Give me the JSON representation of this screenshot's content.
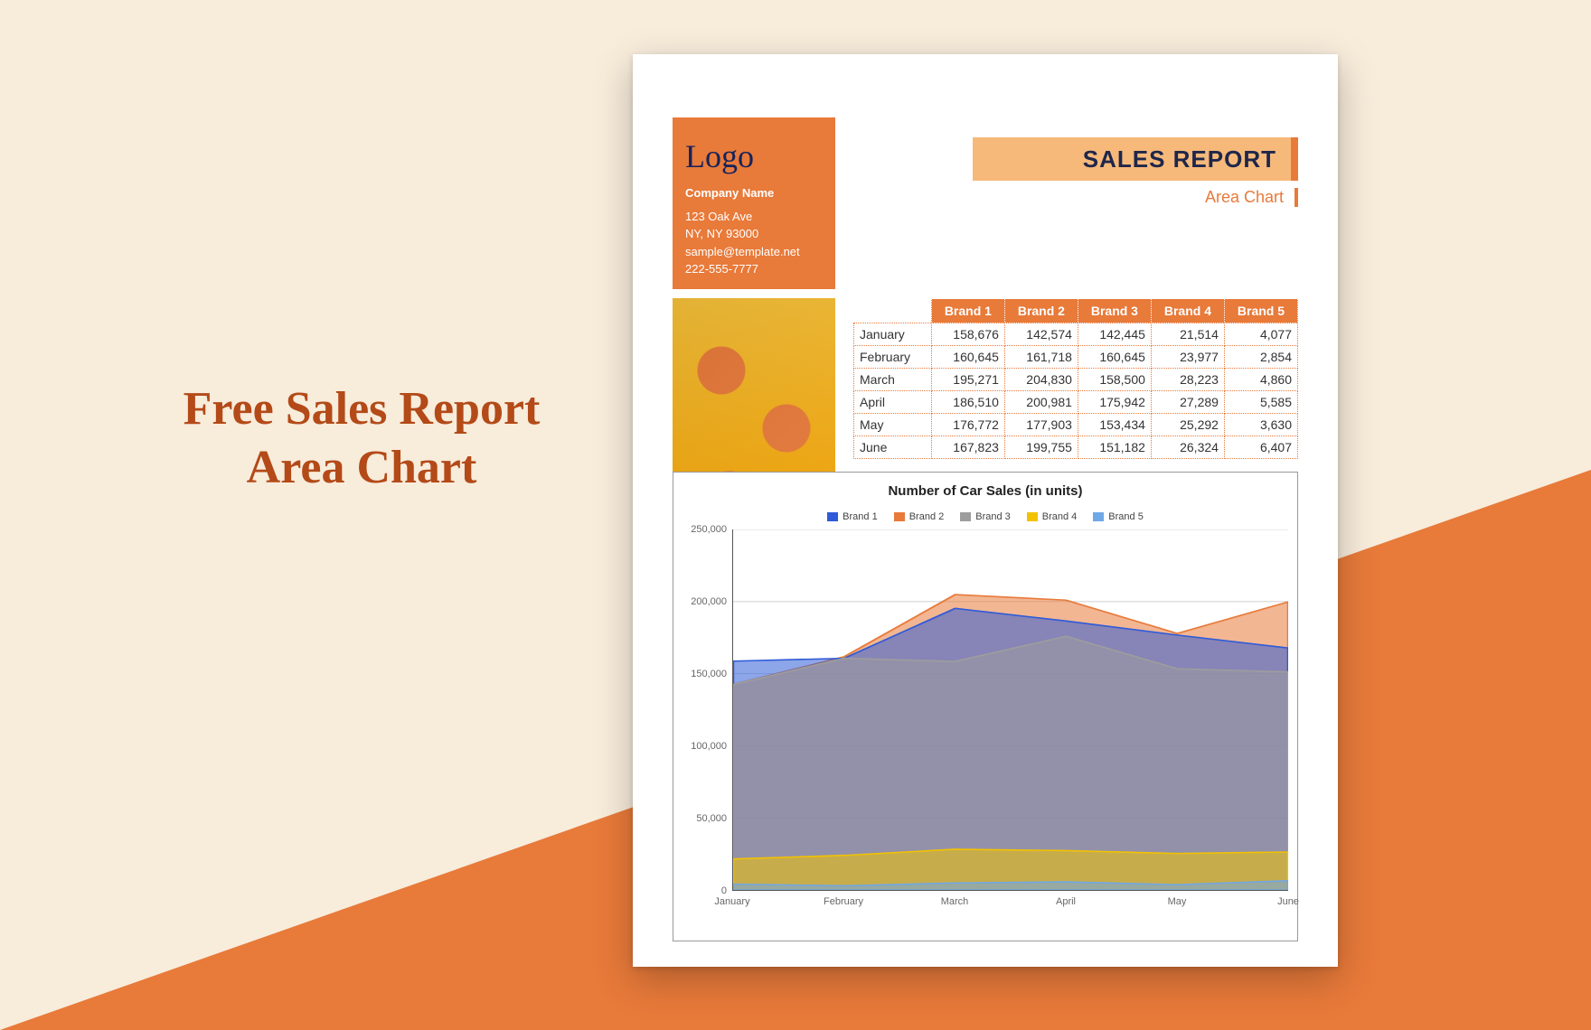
{
  "headline_l1": "Free Sales Report",
  "headline_l2": "Area Chart",
  "logo_text": "Logo",
  "company": {
    "name": "Company Name",
    "addr1": "123 Oak Ave",
    "addr2": "NY, NY 93000",
    "email": "sample@template.net",
    "phone": "222-555-7777"
  },
  "title": "SALES REPORT",
  "subtitle": "Area Chart",
  "table": {
    "cols": [
      "",
      "Brand 1",
      "Brand 2",
      "Brand 3",
      "Brand 4",
      "Brand 5"
    ],
    "rows": [
      [
        "January",
        "158,676",
        "142,574",
        "142,445",
        "21,514",
        "4,077"
      ],
      [
        "February",
        "160,645",
        "161,718",
        "160,645",
        "23,977",
        "2,854"
      ],
      [
        "March",
        "195,271",
        "204,830",
        "158,500",
        "28,223",
        "4,860"
      ],
      [
        "April",
        "186,510",
        "200,981",
        "175,942",
        "27,289",
        "5,585"
      ],
      [
        "May",
        "176,772",
        "177,903",
        "153,434",
        "25,292",
        "3,630"
      ],
      [
        "June",
        "167,823",
        "199,755",
        "151,182",
        "26,324",
        "6,407"
      ]
    ]
  },
  "chart_data": {
    "type": "area",
    "title": "Number of Car Sales (in units)",
    "xlabel": "",
    "ylabel": "",
    "ylim": [
      0,
      250000
    ],
    "yticks": [
      0,
      50000,
      100000,
      150000,
      200000,
      250000
    ],
    "categories": [
      "January",
      "February",
      "March",
      "April",
      "May",
      "June"
    ],
    "series": [
      {
        "name": "Brand 1",
        "color": "#2f5bd7",
        "values": [
          158676,
          160645,
          195271,
          186510,
          176772,
          167823
        ]
      },
      {
        "name": "Brand 2",
        "color": "#e87a3a",
        "values": [
          142574,
          161718,
          204830,
          200981,
          177903,
          199755
        ]
      },
      {
        "name": "Brand 3",
        "color": "#9d9d9d",
        "values": [
          142445,
          160645,
          158500,
          175942,
          153434,
          151182
        ]
      },
      {
        "name": "Brand 4",
        "color": "#f2c200",
        "values": [
          21514,
          23977,
          28223,
          27289,
          25292,
          26324
        ]
      },
      {
        "name": "Brand 5",
        "color": "#6fa8e6",
        "values": [
          4077,
          2854,
          4860,
          5585,
          3630,
          6407
        ]
      }
    ]
  }
}
